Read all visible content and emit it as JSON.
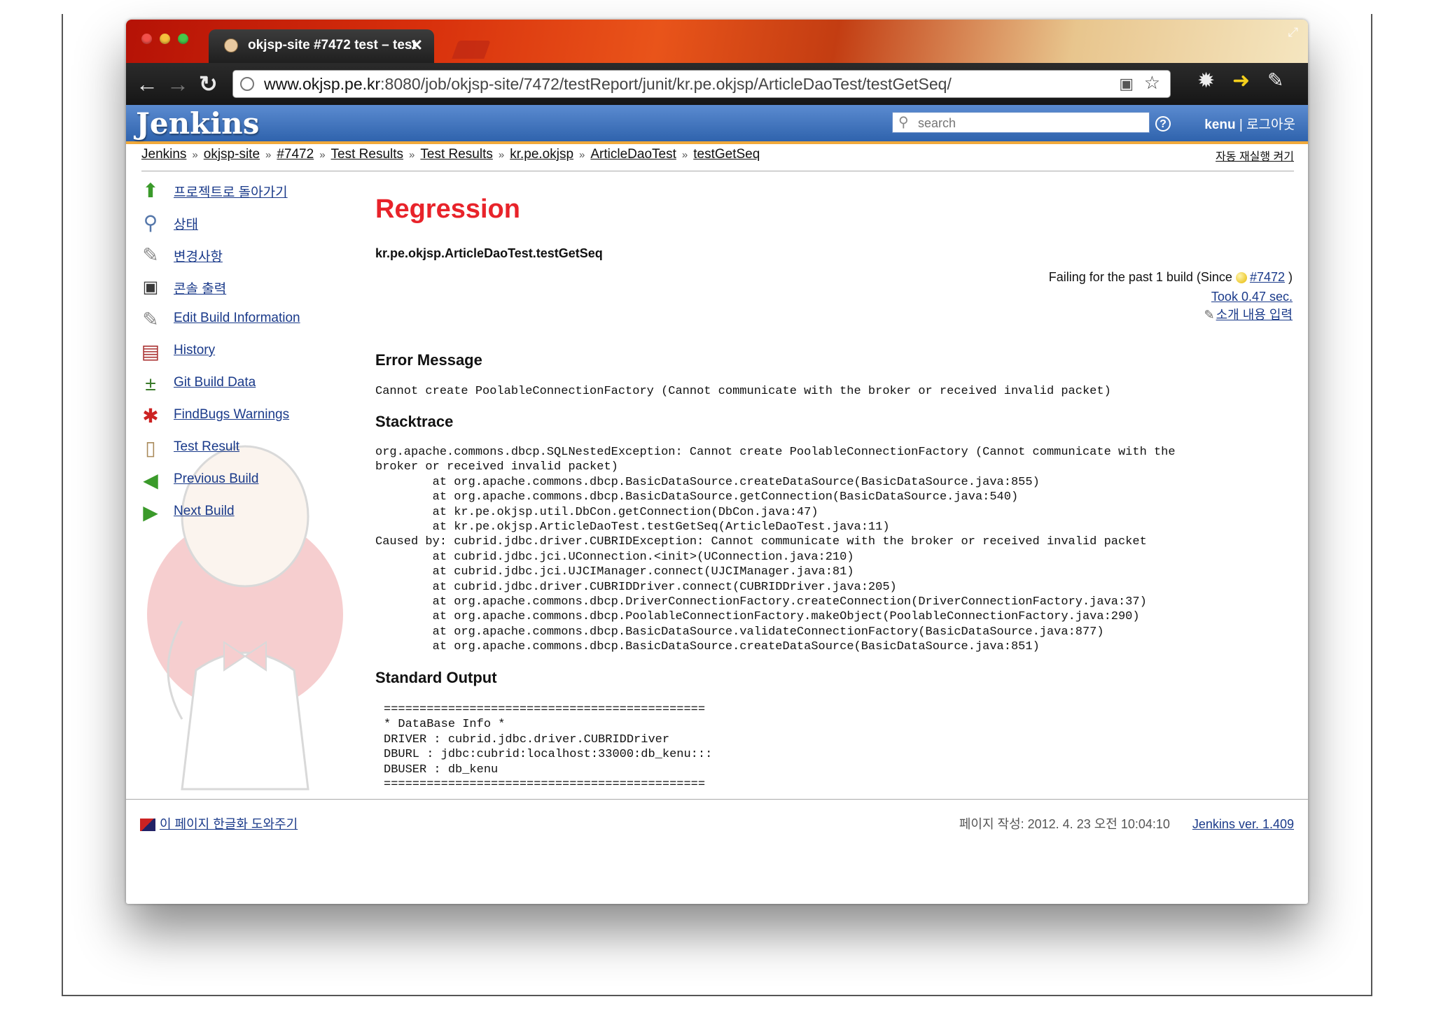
{
  "browser": {
    "tab_title": "okjsp-site #7472 test – test",
    "tab_close": "✕",
    "url_host": "www.okjsp.pe.kr",
    "url_rest": ":8080/job/okjsp-site/7472/testReport/junit/kr.pe.okjsp/ArticleDaoTest/testGetSeq/"
  },
  "header": {
    "logo": "Jenkins",
    "search_placeholder": "search",
    "user": "kenu",
    "separator": " | ",
    "logout": "로그아웃"
  },
  "breadcrumbs": [
    "Jenkins",
    "okjsp-site",
    "#7472",
    "Test Results",
    "Test Results",
    "kr.pe.okjsp",
    "ArticleDaoTest",
    "testGetSeq"
  ],
  "breadcrumb_sep": "»",
  "auto_refresh": "자동 재실행 켜기",
  "sidebar": {
    "items": [
      {
        "label": "프로젝트로 돌아가기",
        "icon": "up-arrow-icon"
      },
      {
        "label": "상태",
        "icon": "magnifier-icon"
      },
      {
        "label": "변경사항",
        "icon": "notepad-icon"
      },
      {
        "label": "콘솔 출력",
        "icon": "terminal-icon"
      },
      {
        "label": "Edit Build Information",
        "icon": "notepad-pencil-icon"
      },
      {
        "label": "History",
        "icon": "history-icon"
      },
      {
        "label": "Git Build Data",
        "icon": "git-icon"
      },
      {
        "label": "FindBugs Warnings",
        "icon": "bug-icon"
      },
      {
        "label": "Test Result",
        "icon": "clipboard-icon"
      },
      {
        "label": "Previous Build",
        "icon": "left-arrow-icon"
      },
      {
        "label": "Next Build",
        "icon": "right-arrow-icon"
      }
    ]
  },
  "main": {
    "title": "Regression",
    "test_name": "kr.pe.okjsp.ArticleDaoTest.testGetSeq",
    "failing_prefix": "Failing for the past 1 build (Since ",
    "failing_build": "#7472",
    "failing_suffix": " )",
    "took": "Took 0.47 sec.",
    "add_description": "소개 내용 입력",
    "error_heading": "Error Message",
    "error_message": "Cannot create PoolableConnectionFactory (Cannot communicate with the broker or received invalid packet)",
    "stacktrace_heading": "Stacktrace",
    "stacktrace": "org.apache.commons.dbcp.SQLNestedException: Cannot create PoolableConnectionFactory (Cannot communicate with the\nbroker or received invalid packet)\n\tat org.apache.commons.dbcp.BasicDataSource.createDataSource(BasicDataSource.java:855)\n\tat org.apache.commons.dbcp.BasicDataSource.getConnection(BasicDataSource.java:540)\n\tat kr.pe.okjsp.util.DbCon.getConnection(DbCon.java:47)\n\tat kr.pe.okjsp.ArticleDaoTest.testGetSeq(ArticleDaoTest.java:11)\nCaused by: cubrid.jdbc.driver.CUBRIDException: Cannot communicate with the broker or received invalid packet\n\tat cubrid.jdbc.jci.UConnection.<init>(UConnection.java:210)\n\tat cubrid.jdbc.jci.UJCIManager.connect(UJCIManager.java:81)\n\tat cubrid.jdbc.driver.CUBRIDDriver.connect(CUBRIDDriver.java:205)\n\tat org.apache.commons.dbcp.DriverConnectionFactory.createConnection(DriverConnectionFactory.java:37)\n\tat org.apache.commons.dbcp.PoolableConnectionFactory.makeObject(PoolableConnectionFactory.java:290)\n\tat org.apache.commons.dbcp.BasicDataSource.validateConnectionFactory(BasicDataSource.java:877)\n\tat org.apache.commons.dbcp.BasicDataSource.createDataSource(BasicDataSource.java:851)",
    "stdout_heading": "Standard Output",
    "stdout": "=============================================\n* DataBase Info *\nDRIVER : cubrid.jdbc.driver.CUBRIDDriver\nDBURL : jdbc:cubrid:localhost:33000:db_kenu:::\nDBUSER : db_kenu\n============================================="
  },
  "footer": {
    "localize": "이 페이지 한글화 도와주기",
    "generated": "페이지 작성: 2012. 4. 23 오전 10:04:10",
    "version": "Jenkins ver. 1.409"
  }
}
